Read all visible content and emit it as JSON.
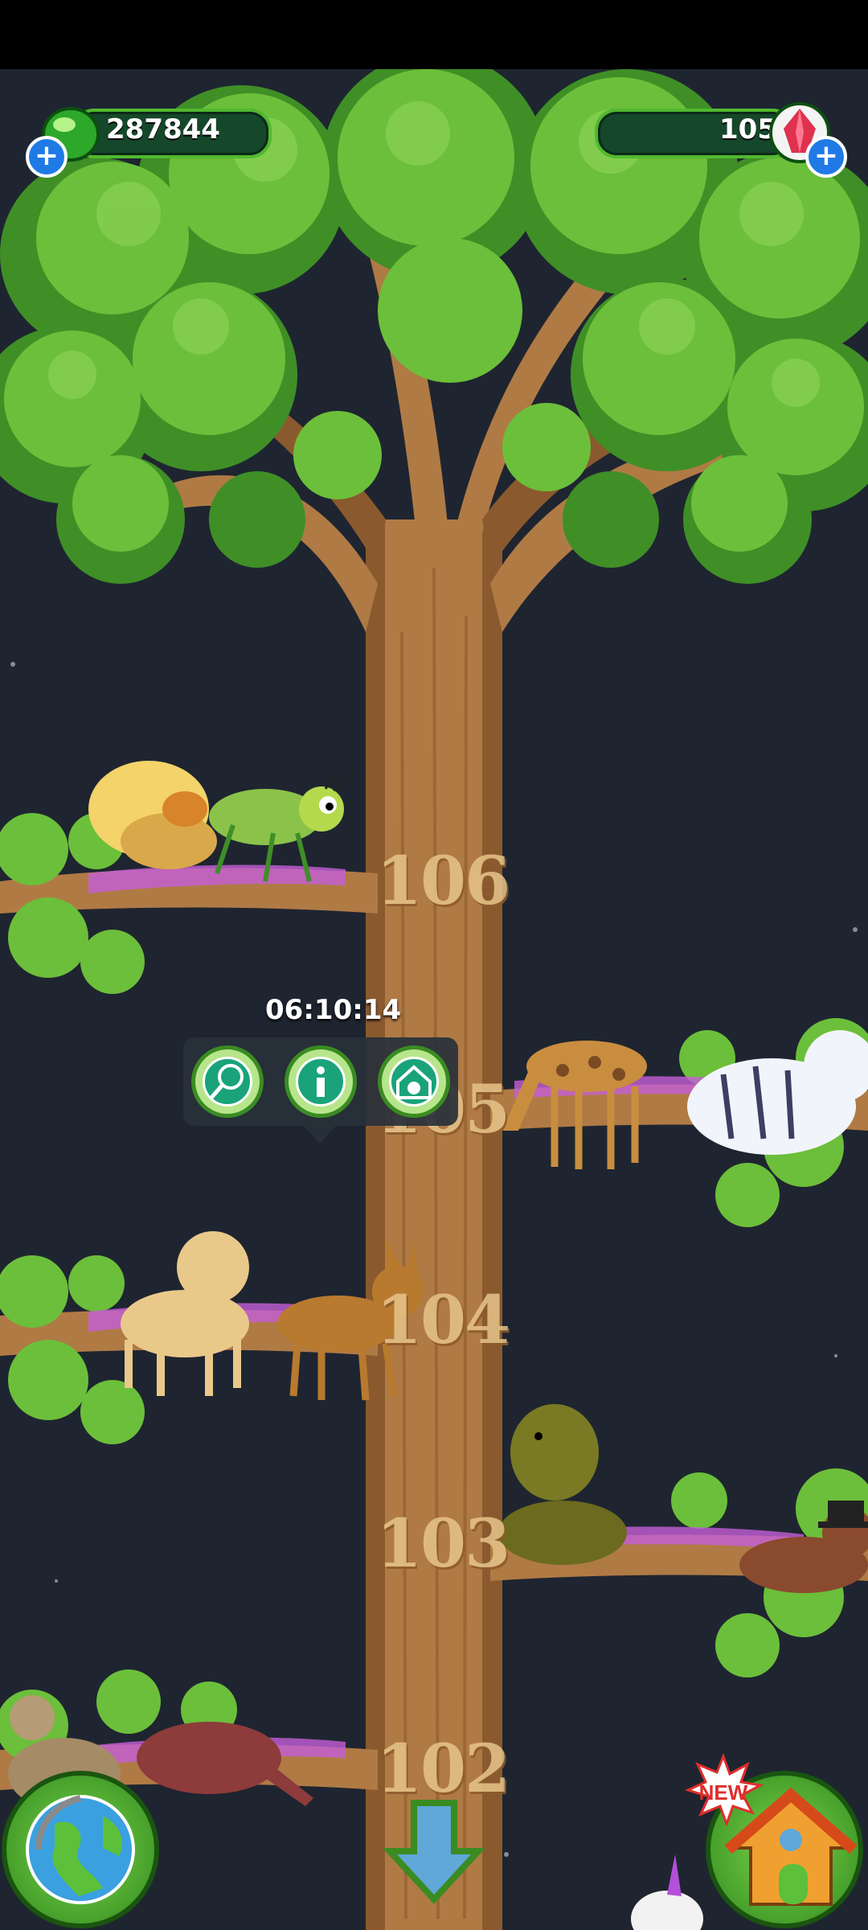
{
  "hud": {
    "gems_value": "287844",
    "crystals_value": "105",
    "add_gems_label": "+",
    "add_crystals_label": "+"
  },
  "tree_levels": [
    "106",
    "105",
    "104",
    "103",
    "102"
  ],
  "timer": "06:10:14",
  "action_buttons": [
    {
      "icon": "net-icon"
    },
    {
      "icon": "info-icon"
    },
    {
      "icon": "shelter-icon"
    }
  ],
  "world_button": {
    "icon": "globe-icon"
  },
  "home_button": {
    "icon": "house-icon",
    "badge": "NEW"
  },
  "scroll_button": {
    "icon": "arrow-down-icon"
  },
  "colors": {
    "background": "#1e2530",
    "leaf": "#6cbf3a",
    "leaf_dark": "#3f8f26",
    "trunk": "#b07a45",
    "trunk_dark": "#8a5a2e",
    "hud_bar": "#15472a",
    "button_green": "#3a8b22"
  }
}
